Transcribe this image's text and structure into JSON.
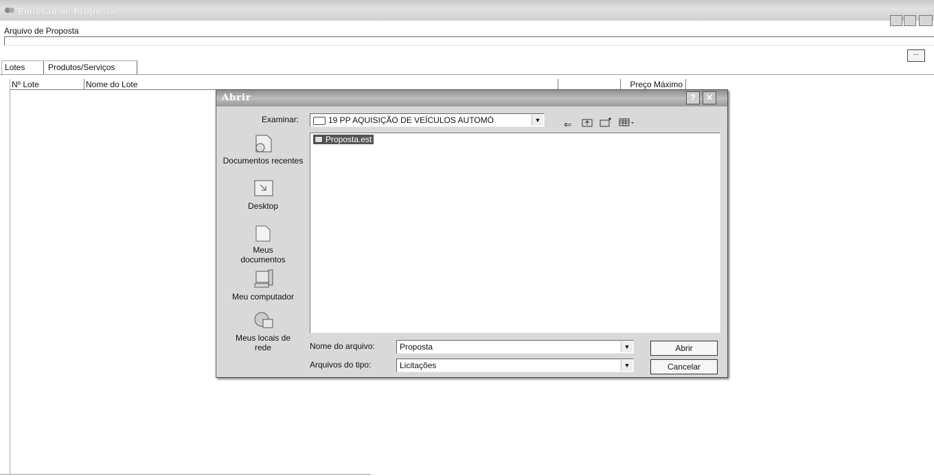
{
  "window": {
    "title": "Emissão de Proposta"
  },
  "main": {
    "file_label": "Arquivo de Proposta",
    "file_value": "",
    "browse_label": "...",
    "tabs": [
      {
        "label": "Lotes"
      },
      {
        "label": "Produtos/Serviços"
      }
    ],
    "columns": [
      "Nº Lote",
      "Nome do Lote",
      "Preço Máximo"
    ]
  },
  "dialog": {
    "title": "Abrir",
    "look_in_label": "Examinar:",
    "look_in_value": "19 PP AQUISIÇÃO DE VEÍCULOS AUTOMÓ",
    "places": [
      {
        "label": "Documentos recentes",
        "icon": "recent-documents-icon"
      },
      {
        "label": "Desktop",
        "icon": "desktop-icon"
      },
      {
        "label": "Meus documentos",
        "icon": "my-documents-icon"
      },
      {
        "label": "Meu computador",
        "icon": "my-computer-icon"
      },
      {
        "label": "Meus locais de rede",
        "icon": "network-places-icon"
      }
    ],
    "files": [
      {
        "name": "Proposta.est",
        "selected": true
      }
    ],
    "filename_label": "Nome do arquivo:",
    "filename_value": "Proposta",
    "filetype_label": "Arquivos do tipo:",
    "filetype_value": "Licitações",
    "open_button": "Abrir",
    "cancel_button": "Cancelar",
    "help_button": "?",
    "close_button": "✕"
  }
}
